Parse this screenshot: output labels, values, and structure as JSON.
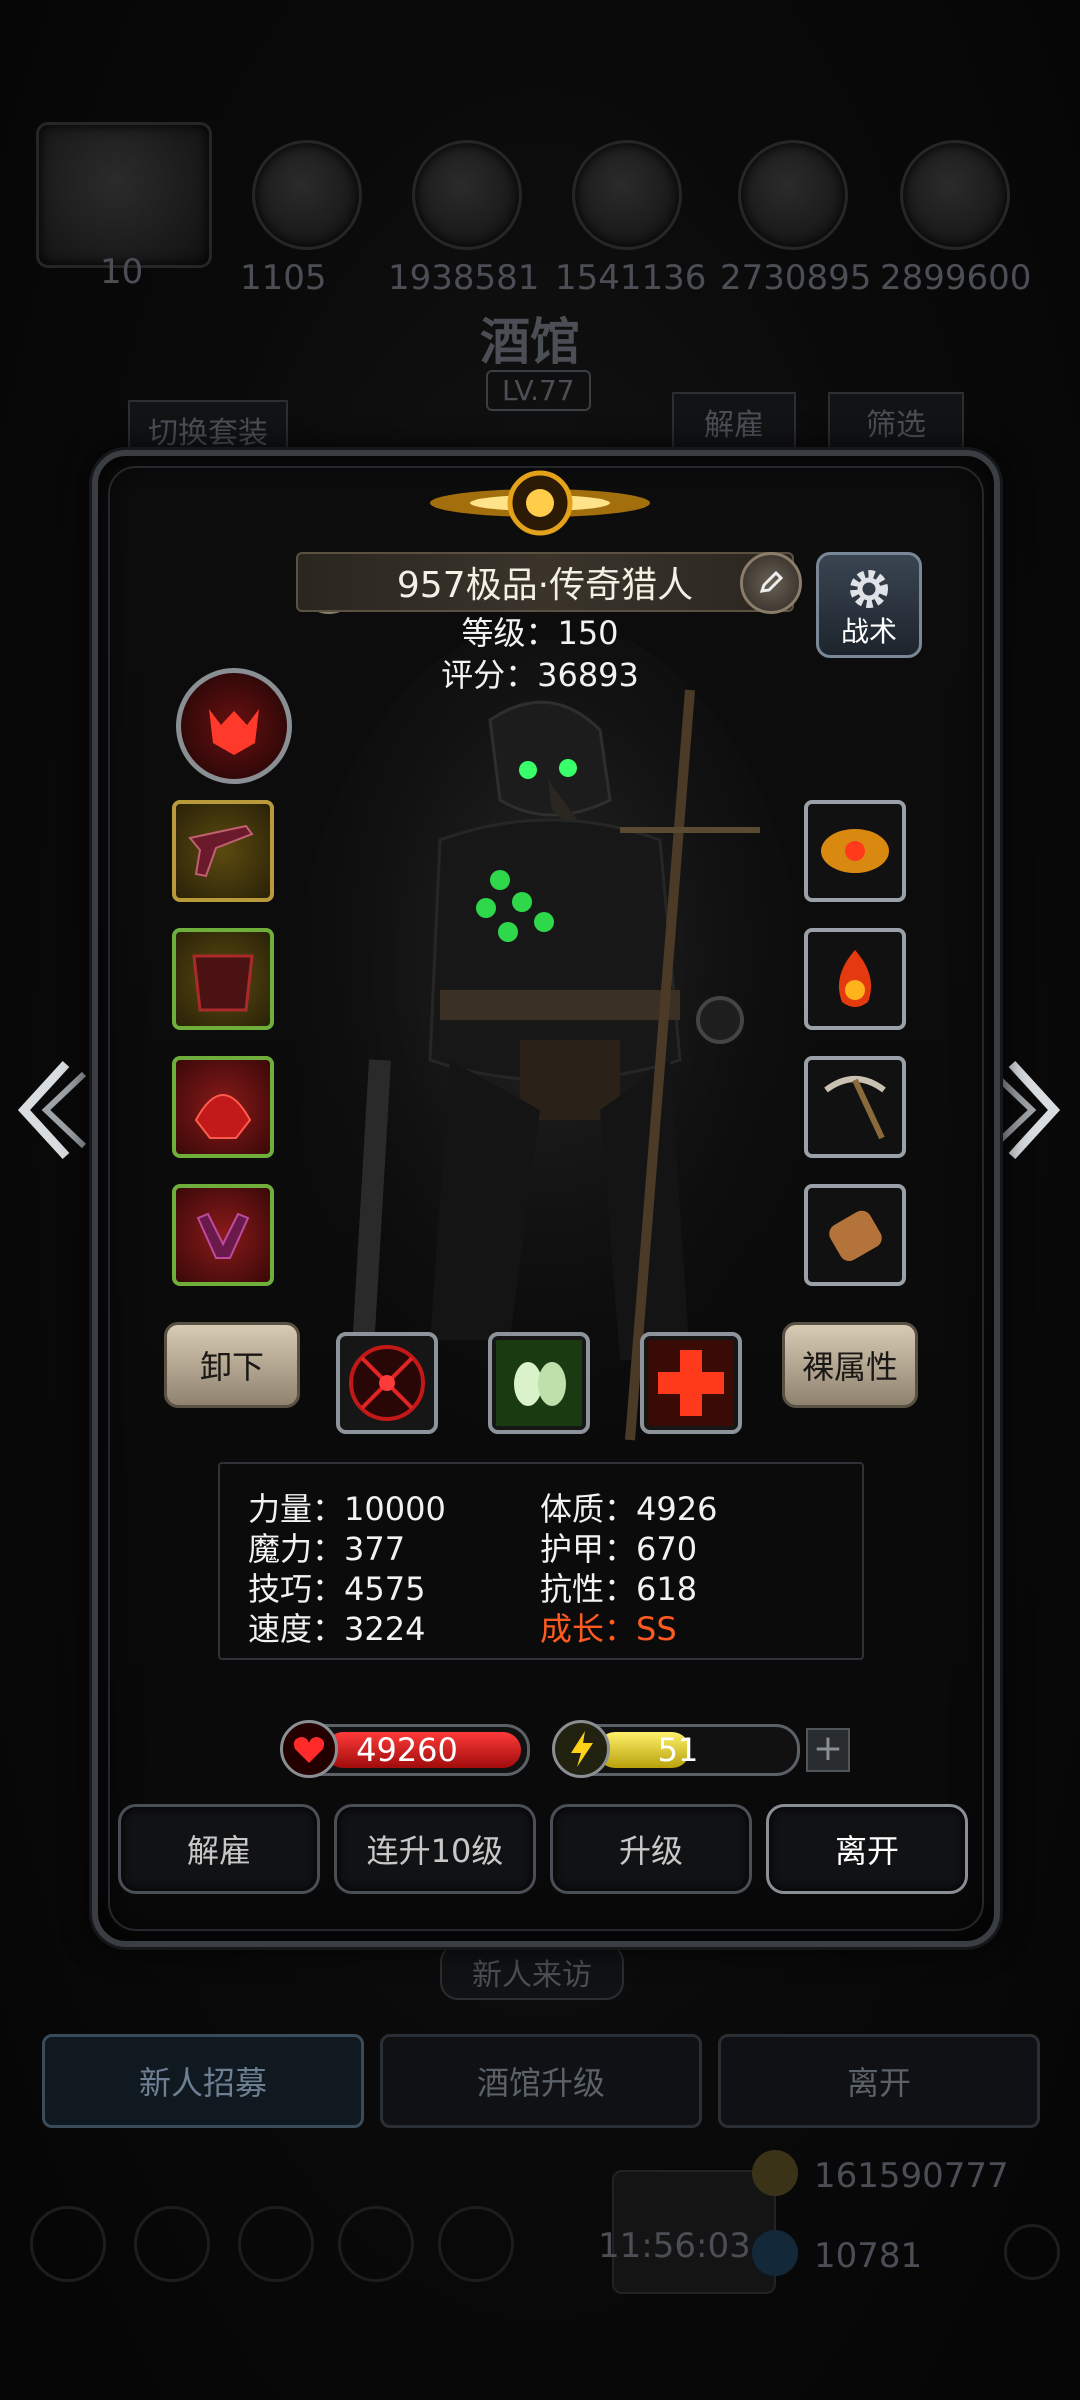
{
  "background": {
    "top_resources": [
      "1105",
      "1938581",
      "1541136",
      "2730895",
      "2899600"
    ],
    "level_badge": "10",
    "tavern_title": "酒馆",
    "tavern_level": "LV.77",
    "switch_outfit": "切换套装",
    "dismiss": "解雇",
    "filter": "筛选",
    "new_visitor": "新人来访",
    "tabs": [
      "新人招募",
      "酒馆升级",
      "离开"
    ],
    "gold": "161590777",
    "gems": "10781",
    "clock": "11:56:03"
  },
  "hero": {
    "name": "957极品·传奇猎人",
    "level_label": "等级：150",
    "score_label": "评分：36893",
    "tactics_label": "战术"
  },
  "buttons": {
    "unequip": "卸下",
    "naked_attr": "裸属性"
  },
  "attributes": [
    {
      "label": "力量：10000"
    },
    {
      "label": "魔力：377"
    },
    {
      "label": "技巧：4575"
    },
    {
      "label": "速度：3224"
    },
    {
      "label": "体质：4926"
    },
    {
      "label": "护甲：670"
    },
    {
      "label": "抗性：618"
    },
    {
      "label": "成长：SS"
    }
  ],
  "bars": {
    "hp": "49260",
    "energy": "51",
    "energy_fill_fraction": 0.48
  },
  "actions": [
    "解雇",
    "连升10级",
    "升级",
    "离开"
  ],
  "colors": {
    "growth": "#ff5a1f",
    "hp_bar": "#d41818",
    "energy_bar": "#e3d21a"
  },
  "icons": {
    "left_nav": "chevron-left-icon",
    "right_nav": "chevron-right-icon",
    "class_icon": "demon-mask-icon",
    "tactics": "gear-icon",
    "edit": "pencil-icon"
  }
}
